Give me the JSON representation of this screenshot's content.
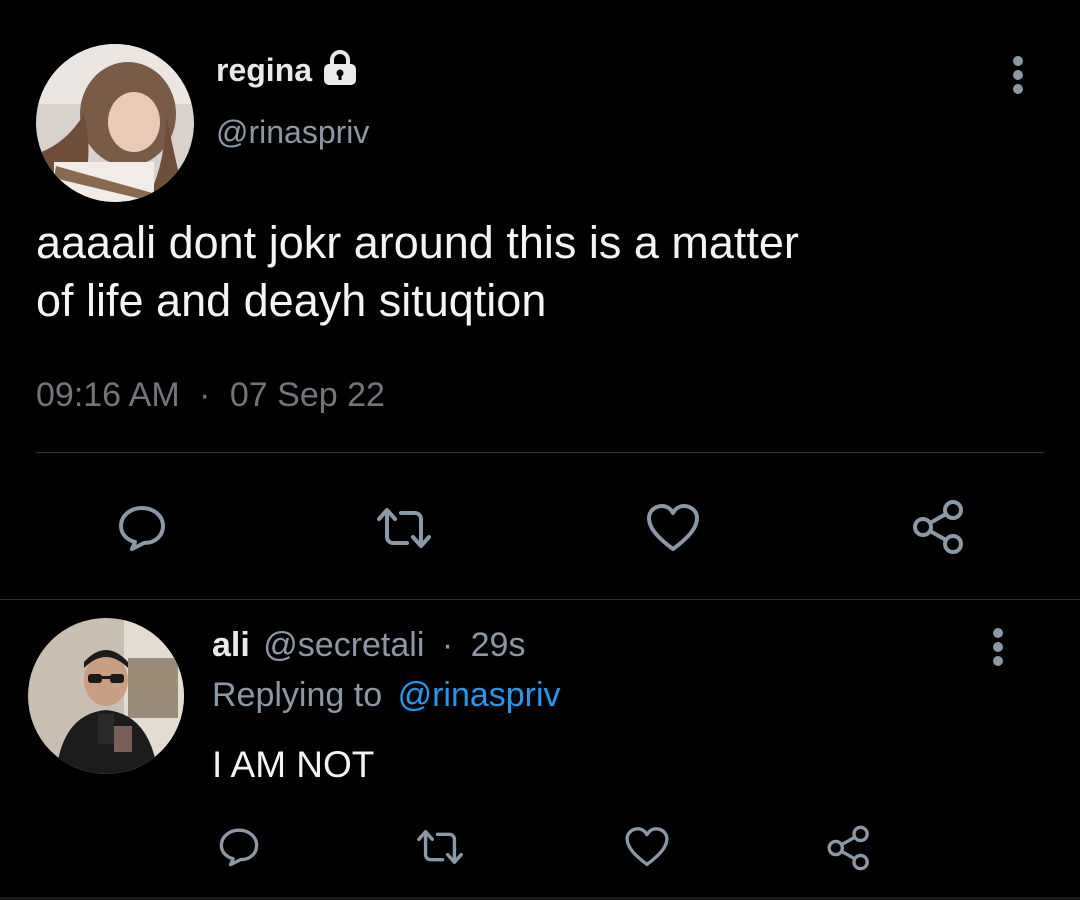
{
  "main_tweet": {
    "display_name": "regina",
    "handle": "@rinaspriv",
    "text_line1": "aaaali dont jokr around this is a matter",
    "text_line2": "of life and deayh situqtion",
    "time": "09:16 AM",
    "separator": "·",
    "date": "07 Sep 22"
  },
  "reply_tweet": {
    "display_name": "ali",
    "handle": "@secretali",
    "separator": "·",
    "age": "29s",
    "replying_prefix": "Replying to",
    "replying_handle": "@rinaspriv",
    "text": "I AM NOT"
  },
  "icons": {
    "lock": "lock-icon",
    "more": "more-vertical-icon",
    "reply": "reply-icon",
    "retweet": "retweet-icon",
    "like": "heart-icon",
    "share": "share-icon"
  },
  "colors": {
    "background": "#000000",
    "text": "#e7e9ea",
    "muted": "#71767b",
    "link": "#1d9bf0",
    "divider": "#2f3336"
  }
}
